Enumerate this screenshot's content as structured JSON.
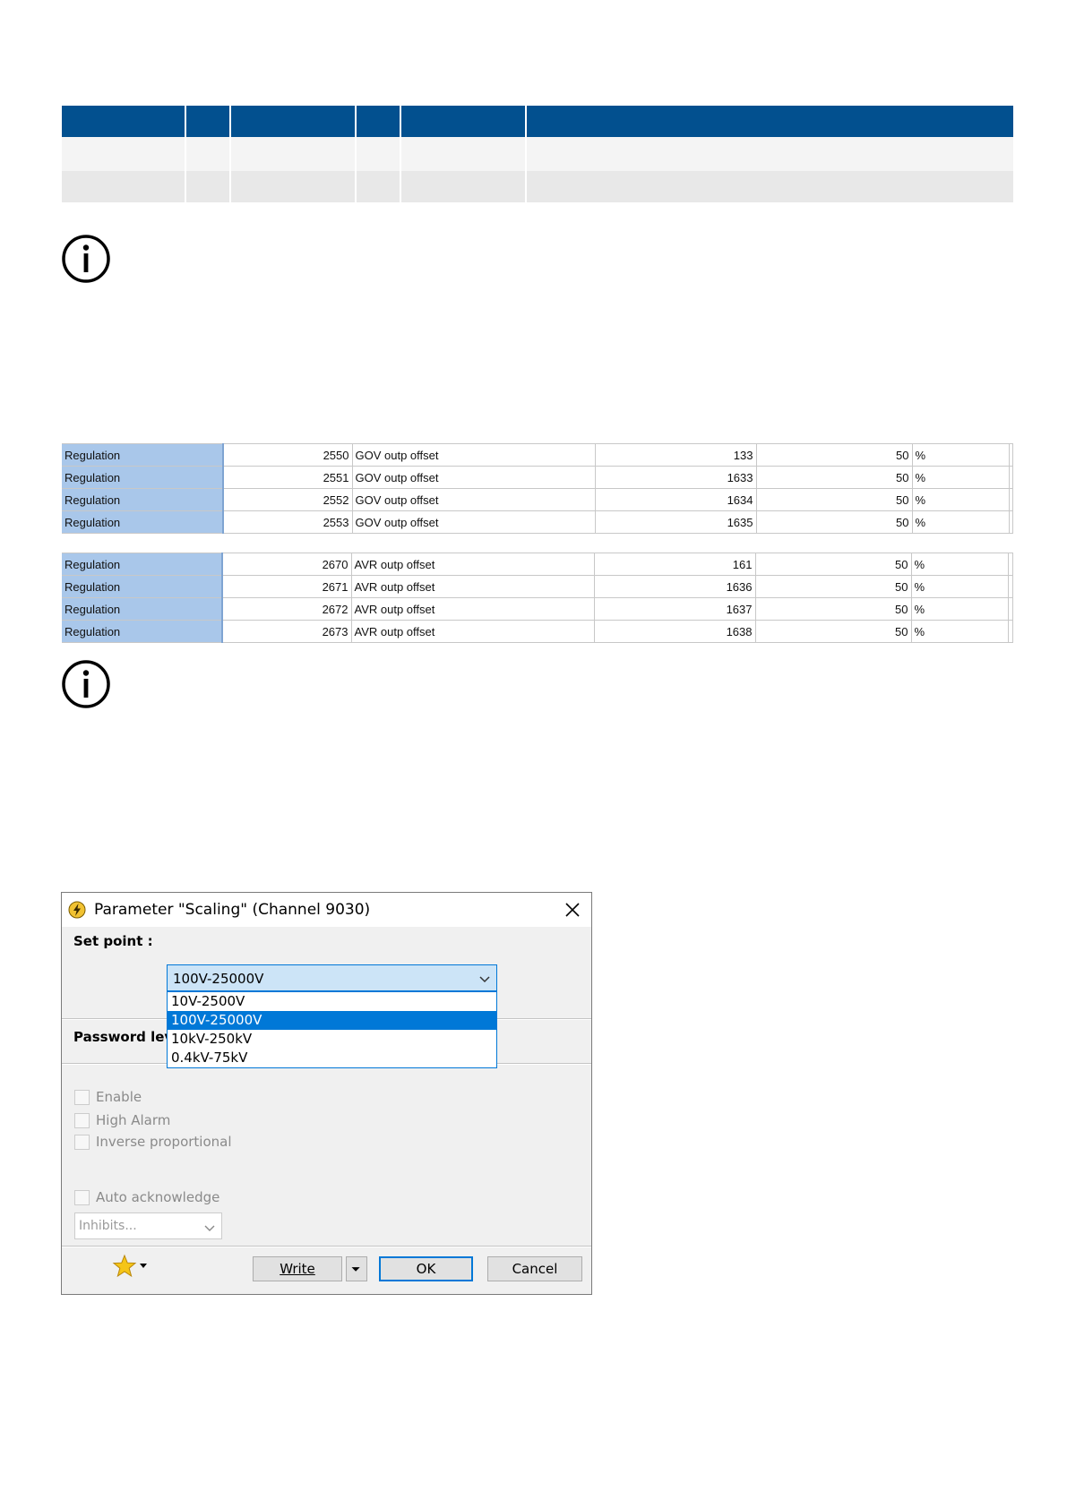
{
  "sheet1": {
    "rows": [
      {
        "category": "Regulation",
        "param": "2550",
        "name": "GOV outp offset",
        "id": "133",
        "value": "50",
        "unit": "%"
      },
      {
        "category": "Regulation",
        "param": "2551",
        "name": "GOV outp offset",
        "id": "1633",
        "value": "50",
        "unit": "%"
      },
      {
        "category": "Regulation",
        "param": "2552",
        "name": "GOV outp offset",
        "id": "1634",
        "value": "50",
        "unit": "%"
      },
      {
        "category": "Regulation",
        "param": "2553",
        "name": "GOV outp offset",
        "id": "1635",
        "value": "50",
        "unit": "%"
      }
    ]
  },
  "sheet2": {
    "rows": [
      {
        "category": "Regulation",
        "param": "2670",
        "name": "AVR outp offset",
        "id": "161",
        "value": "50",
        "unit": "%"
      },
      {
        "category": "Regulation",
        "param": "2671",
        "name": "AVR outp offset",
        "id": "1636",
        "value": "50",
        "unit": "%"
      },
      {
        "category": "Regulation",
        "param": "2672",
        "name": "AVR outp offset",
        "id": "1637",
        "value": "50",
        "unit": "%"
      },
      {
        "category": "Regulation",
        "param": "2673",
        "name": "AVR outp offset",
        "id": "1638",
        "value": "50",
        "unit": "%"
      }
    ]
  },
  "dialog": {
    "title": "Parameter \"Scaling\" (Channel 9030)",
    "setpoint_label": "Set point :",
    "combo_value": "100V-25000V",
    "options": [
      "10V-2500V",
      "100V-25000V",
      "10kV-250kV",
      "0.4kV-75kV"
    ],
    "password_label": "Password level",
    "enable_label": "Enable",
    "high_alarm_label": "High Alarm",
    "inverse_label": "Inverse proportional",
    "auto_ack_label": "Auto acknowledge",
    "inhibits_placeholder": "Inhibits...",
    "write_label": "Write",
    "ok_label": "OK",
    "cancel_label": "Cancel"
  },
  "colors": {
    "header_blue": "#02508f",
    "category_fill": "#a9c7ea",
    "selection_blue": "#0078d7",
    "star_yellow": "#f5c518"
  },
  "icons": [
    "info-icon",
    "warning-circle-icon",
    "close-icon",
    "chevron-down-icon",
    "star-icon",
    "dropdown-arrow-icon"
  ]
}
